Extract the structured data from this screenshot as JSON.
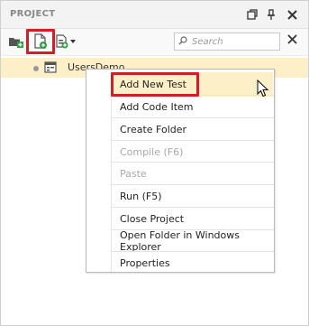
{
  "panel": {
    "title": "PROJECT"
  },
  "titlebar_icons": [
    "restore-icon",
    "pin-icon",
    "close-icon"
  ],
  "toolbar": {
    "tools": [
      "open-folder-icon",
      "new-test-icon",
      "new-code-item-icon"
    ],
    "search_placeholder": "Search"
  },
  "tree": {
    "item_label": "UsersDemo"
  },
  "context_menu": {
    "items": [
      {
        "label": "Add New Test",
        "enabled": true,
        "highlighted": true
      },
      {
        "label": "Add Code Item",
        "enabled": true
      },
      {
        "label": "Create Folder",
        "enabled": true
      },
      {
        "label": "Compile (F6)",
        "enabled": false
      },
      {
        "label": "Paste",
        "enabled": false
      },
      {
        "label": "Run (F5)",
        "enabled": true
      },
      {
        "label": "Close Project",
        "enabled": true
      },
      {
        "label": "Open Folder in Windows Explorer",
        "enabled": true
      },
      {
        "label": "Properties",
        "enabled": true
      }
    ]
  },
  "colors": {
    "highlight_border": "#d21f26",
    "selection_bg": "#fdf0c8",
    "disabled_text": "#a8a8a8"
  }
}
